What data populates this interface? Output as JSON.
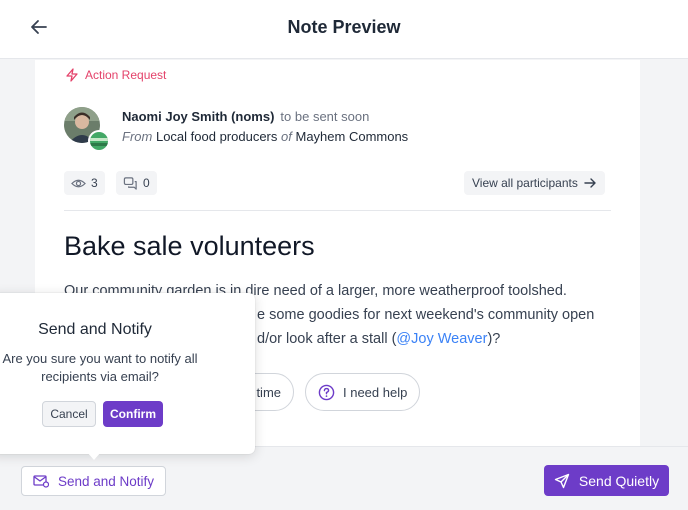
{
  "header": {
    "title": "Note Preview"
  },
  "note": {
    "tag": "Action Request",
    "sender": {
      "name": "Naomi Joy Smith (noms)",
      "status": "to be sent soon",
      "from_label": "From",
      "group": "Local food producers",
      "of_label": "of",
      "community": "Mayhem Commons"
    },
    "stats": {
      "views": "3",
      "comments": "0",
      "participants_label": "View all participants"
    },
    "title": "Bake sale volunteers",
    "body": {
      "line1": "Our community garden is in dire need of a larger, more weatherproof toolshed.",
      "line2": "e some goodies for next weekend's community open",
      "line3_pre": "d/or look after a stall (",
      "mention": "@Joy Weaver",
      "line3_post": ")?"
    },
    "replies": {
      "time_label": "time",
      "help_label": "I need help"
    }
  },
  "bottom_bar": {
    "notify_label": "Send and Notify",
    "quiet_label": "Send Quietly"
  },
  "popover": {
    "title": "Send and Notify",
    "message": "Are you sure you want to notify all recipients via email?",
    "cancel_label": "Cancel",
    "confirm_label": "Confirm"
  },
  "colors": {
    "accent": "#6d3cc8",
    "action": "#e4426a",
    "mention": "#3b82f6"
  }
}
